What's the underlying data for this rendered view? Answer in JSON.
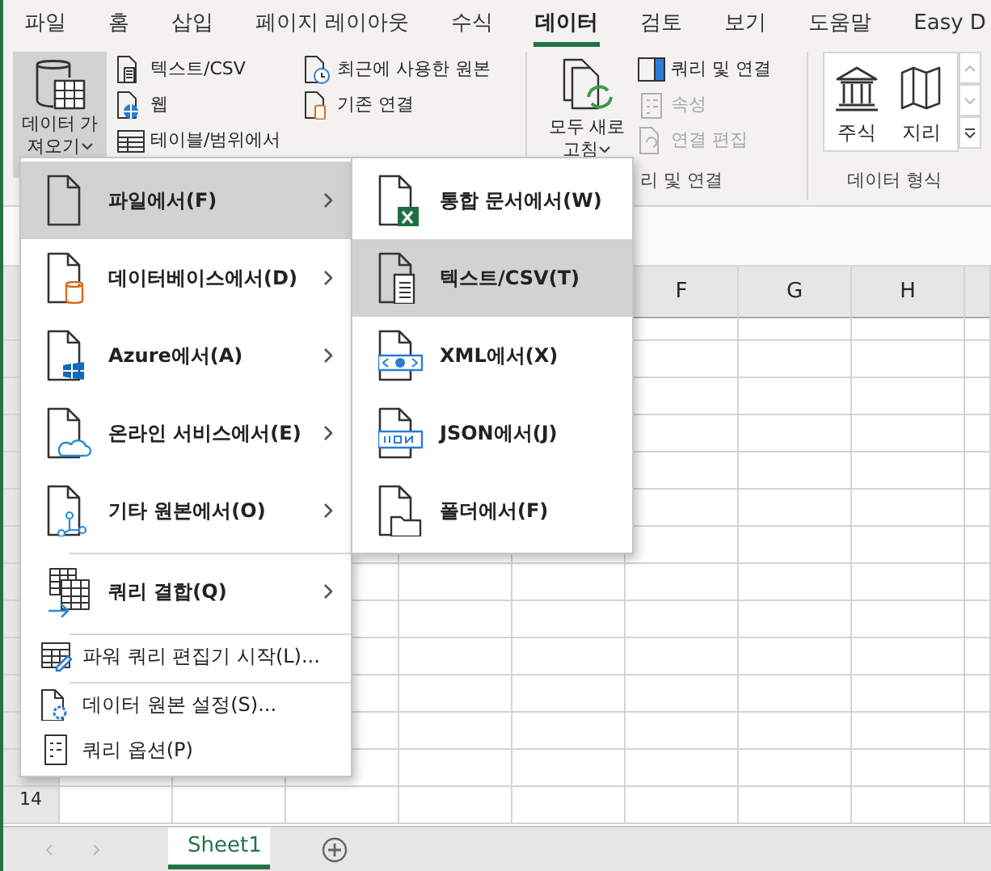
{
  "ribbon_tabs": [
    {
      "label": "파일",
      "selected": false
    },
    {
      "label": "홈",
      "selected": false
    },
    {
      "label": "삽입",
      "selected": false
    },
    {
      "label": "페이지 레이아웃",
      "selected": false
    },
    {
      "label": "수식",
      "selected": false
    },
    {
      "label": "데이터",
      "selected": true
    },
    {
      "label": "검토",
      "selected": false
    },
    {
      "label": "보기",
      "selected": false
    },
    {
      "label": "도움말",
      "selected": false
    },
    {
      "label": "Easy D",
      "selected": false
    }
  ],
  "get_data_group": {
    "large_button": "데이터 가져오기",
    "expanded": true,
    "small_buttons": [
      {
        "label": "텍스트/CSV"
      },
      {
        "label": "웹"
      },
      {
        "label": "테이블/범위에서"
      },
      {
        "label": "최근에 사용한 원본"
      },
      {
        "label": "기존 연결"
      }
    ]
  },
  "queries_group": {
    "large_button": "모두 새로 고침",
    "group_label": "리 및 연결",
    "small_buttons": [
      {
        "label": "쿼리 및 연결",
        "disabled": false
      },
      {
        "label": "속성",
        "disabled": true
      },
      {
        "label": "연결 편집",
        "disabled": true
      }
    ]
  },
  "data_types_group": {
    "items": [
      "주식",
      "지리"
    ],
    "group_label": "데이터 형식"
  },
  "sheet": {
    "column_headers": [
      "F",
      "G",
      "H"
    ],
    "row_headers": [
      "14"
    ]
  },
  "get_data_menu": {
    "items": [
      {
        "label": "파일에서(F)",
        "kind": "large",
        "submenu": true,
        "selected": true,
        "divider_above": false
      },
      {
        "label": "데이터베이스에서(D)",
        "kind": "large",
        "submenu": true,
        "selected": false,
        "divider_above": false
      },
      {
        "label": "Azure에서(A)",
        "kind": "large",
        "submenu": true,
        "selected": false,
        "divider_above": false
      },
      {
        "label": "온라인 서비스에서(E)",
        "kind": "large",
        "submenu": true,
        "selected": false,
        "divider_above": false
      },
      {
        "label": "기타 원본에서(O)",
        "kind": "large",
        "submenu": true,
        "selected": false,
        "divider_above": false
      },
      {
        "label": "쿼리 결합(Q)",
        "kind": "large",
        "submenu": true,
        "selected": false,
        "divider_above": true
      },
      {
        "label": "파워 쿼리 편집기 시작(L)...",
        "kind": "small",
        "submenu": false,
        "selected": false,
        "divider_above": true
      },
      {
        "label": "데이터 원본 설정(S)...",
        "kind": "small",
        "submenu": false,
        "selected": false,
        "divider_above": true
      },
      {
        "label": "쿼리 옵션(P)",
        "kind": "small",
        "submenu": false,
        "selected": false,
        "divider_above": false
      }
    ]
  },
  "from_file_menu": {
    "items": [
      {
        "label": "통합 문서에서(W)",
        "selected": false
      },
      {
        "label": "텍스트/CSV(T)",
        "selected": true
      },
      {
        "label": "XML에서(X)",
        "selected": false
      },
      {
        "label": "JSON에서(J)",
        "selected": false
      },
      {
        "label": "폴더에서(F)",
        "selected": false
      }
    ]
  },
  "sheet_tabs": [
    {
      "label": "Sheet1",
      "selected": true
    }
  ]
}
